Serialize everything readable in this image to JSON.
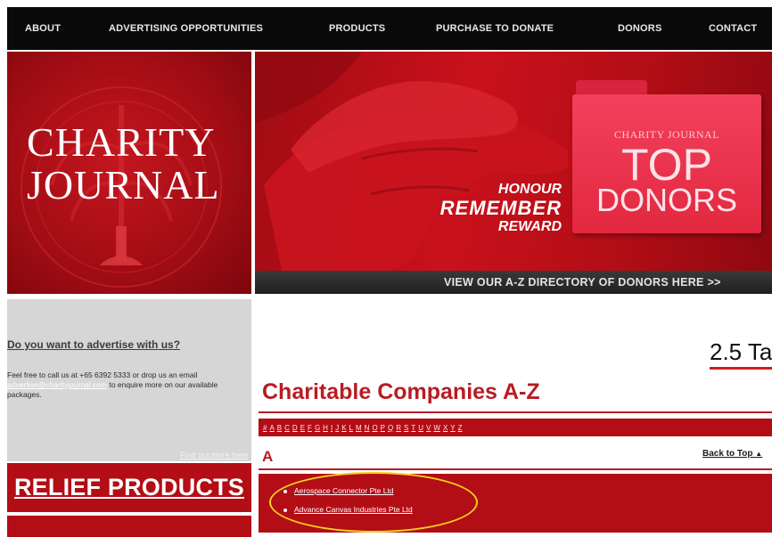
{
  "nav": {
    "items": [
      {
        "label": "ABOUT"
      },
      {
        "label": "ADVERTISING OPPORTUNITIES"
      },
      {
        "label": "PRODUCTS"
      },
      {
        "label": "PURCHASE TO DONATE"
      },
      {
        "label": "DONORS"
      },
      {
        "label": "CONTACT"
      }
    ]
  },
  "logo": {
    "line1": "Charity",
    "line2": "Journal"
  },
  "banner": {
    "slogan_1": "HONOUR",
    "slogan_2": "REMEMBER",
    "slogan_3": "REWARD",
    "folder_small": "Charity Journal",
    "folder_top": "TOP",
    "folder_donors": "DONORS",
    "strip": "VIEW OUR A-Z DIRECTORY OF DONORS HERE >>"
  },
  "advertise": {
    "title": "Do you want to advertise with us?",
    "text_before": "Feel free to call us at +65 6392 5333 or drop us an email ",
    "email": "advertise@charityjournal.com",
    "text_after": " to enquire more on our available packages.",
    "more_link": "Find out more here"
  },
  "relief": {
    "label": "RELIEF PRODUCTS"
  },
  "main": {
    "side_title": "2.5 Ta",
    "heading": "Charitable Companies A-Z",
    "alphabet": [
      "#",
      "A",
      "B",
      "C",
      "D",
      "E",
      "F",
      "G",
      "H",
      "I",
      "J",
      "K",
      "L",
      "M",
      "N",
      "O",
      "P",
      "Q",
      "R",
      "S",
      "T",
      "U",
      "V",
      "W",
      "X",
      "Y",
      "Z"
    ],
    "section_letter": "A",
    "back_to_top": "Back to Top",
    "companies": [
      {
        "name": "Aerospace Connector Pte Ltd"
      },
      {
        "name": "Advance Canvas Industries Pte Ltd"
      }
    ]
  },
  "colors": {
    "brand_red": "#b30d15",
    "highlight": "#f2d21b"
  }
}
